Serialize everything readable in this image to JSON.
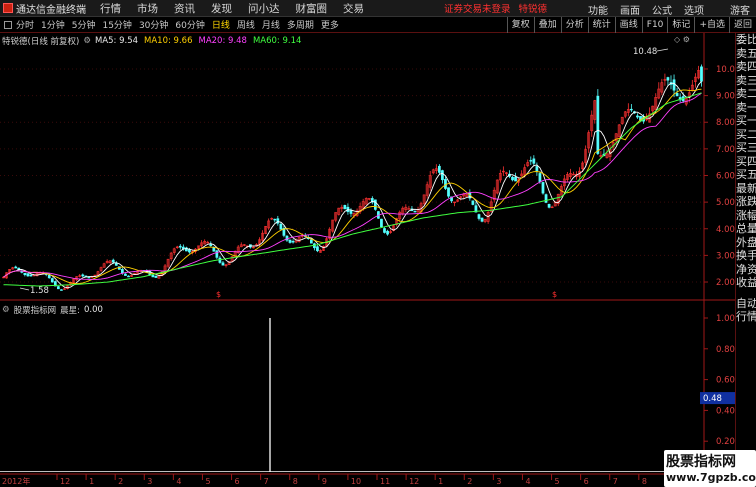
{
  "app": {
    "name": "通达信金融终端",
    "menu": [
      "行情",
      "市场",
      "资讯",
      "发现",
      "问小达",
      "财富圈",
      "交易"
    ],
    "warning": "证券交易未登录",
    "stock_title": "特锐德",
    "right_menu": [
      "功能",
      "画面",
      "公式",
      "选项"
    ],
    "guest": "游客"
  },
  "toolbar": {
    "periods": [
      "分时",
      "1分钟",
      "5分钟",
      "15分钟",
      "30分钟",
      "60分钟",
      "日线",
      "周线",
      "月线",
      "多周期",
      "更多"
    ],
    "active_period": "日线",
    "buttons": [
      "复权",
      "叠加",
      "分析",
      "统计",
      "画线",
      "F10",
      "标记",
      "+自选",
      "返回"
    ]
  },
  "main_chart": {
    "title": "特锐德(日线 前复权)",
    "ma5": "MA5: 9.54",
    "ma10": "MA10: 9.66",
    "ma20": "MA20: 9.48",
    "ma60": "MA60: 9.14",
    "y_ticks": [
      "10.00",
      "9.00",
      "8.00",
      "7.00",
      "6.00",
      "5.00",
      "4.00",
      "3.00",
      "2.00"
    ],
    "high_label": "10.48",
    "low_label": "1.58",
    "marker": "$"
  },
  "indicator": {
    "source": "股票指标网",
    "name": "晨星:",
    "value": "0.00",
    "y_ticks": [
      "1.00",
      "0.80",
      "0.60",
      "0.40",
      "0.20"
    ],
    "current": "0.48"
  },
  "x_axis": {
    "year": "2012年",
    "labels": [
      "12",
      "1",
      "2",
      "3",
      "4",
      "5",
      "6",
      "7",
      "8",
      "9",
      "10",
      "11",
      "12",
      "1",
      "2",
      "3",
      "4",
      "5",
      "6",
      "7",
      "8",
      "9"
    ]
  },
  "sidebar": [
    "委比",
    "卖五",
    "卖四",
    "卖三",
    "卖二",
    "卖一",
    "买一",
    "买二",
    "买三",
    "买四",
    "买五",
    "最新",
    "涨跌",
    "涨幅",
    "总量",
    "外盘",
    "换手",
    "净资",
    "收益"
  ],
  "sidebar_bottom": [
    "自动",
    "行情"
  ],
  "sidebar_top_small": "500",
  "watermark": {
    "line1": "股票指标网",
    "line2": "www.7gpzb.com"
  },
  "colors": {
    "up": "#ff3232",
    "down": "#54ffff",
    "ma5": "#ffffff",
    "ma10": "#ffd000",
    "ma20": "#ff40ff",
    "ma60": "#40ff40",
    "axis": "#a01818"
  },
  "chart_data": {
    "type": "line",
    "series": [
      {
        "name": "MA60",
        "x": [
          0,
          0.05,
          0.1,
          0.15,
          0.2,
          0.25,
          0.3,
          0.35,
          0.4,
          0.45,
          0.5,
          0.55,
          0.6,
          0.65,
          0.7,
          0.75,
          0.8,
          0.85,
          0.9,
          0.95,
          1.0
        ],
        "values": [
          1.9,
          1.85,
          1.9,
          2.0,
          2.2,
          2.5,
          2.8,
          3.0,
          3.2,
          3.4,
          3.8,
          4.1,
          4.4,
          4.6,
          4.7,
          4.9,
          5.2,
          6.5,
          7.8,
          8.7,
          9.1
        ]
      }
    ],
    "ylim": [
      1.4,
      10.9
    ],
    "indicator_spike": {
      "position": 0.4,
      "value": 1.0
    }
  }
}
